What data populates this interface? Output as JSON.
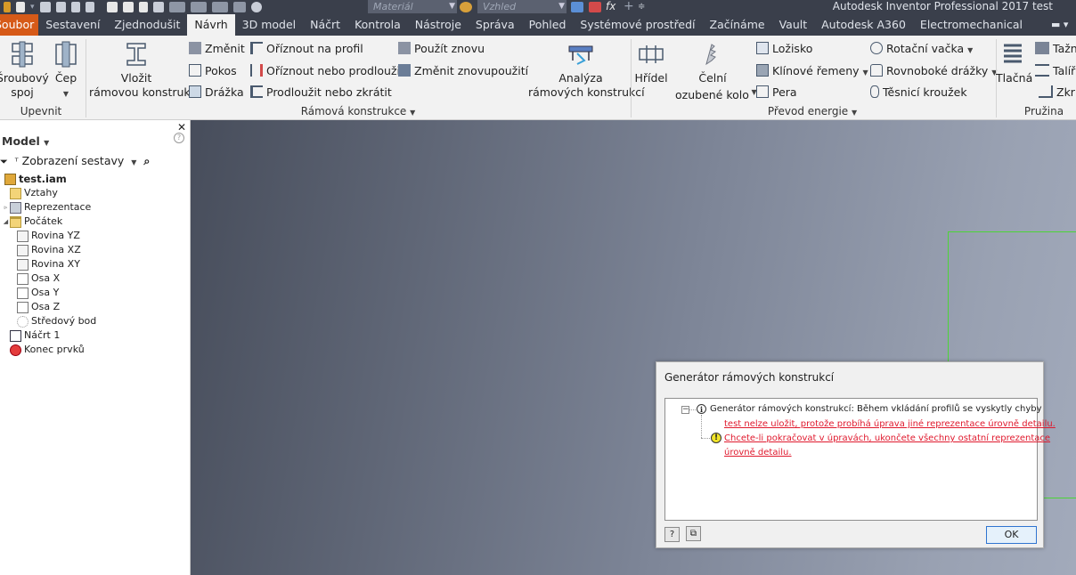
{
  "titlebar": {
    "material_placeholder": "Materiál",
    "appearance_placeholder": "Vzhled",
    "app_title": "Autodesk Inventor Professional 2017   test"
  },
  "tabs": [
    "Soubor",
    "Sestavení",
    "Zjednodušit",
    "Návrh",
    "3D model",
    "Náčrt",
    "Kontrola",
    "Nástroje",
    "Správa",
    "Pohled",
    "Systémové prostředí",
    "Začínáme",
    "Vault",
    "Autodesk A360",
    "Electromechanical"
  ],
  "active_tab": "Návrh",
  "ribbon": {
    "upevnit": {
      "label": "Upevnit",
      "bolt_line1": "Šroubový",
      "bolt_line2": "spoj",
      "pin": "Čep"
    },
    "frame": {
      "label": "Rámová konstrukce",
      "insert_line1": "Vložit",
      "insert_line2": "rámovou konstrukci",
      "change": "Změnit",
      "miter": "Pokos",
      "notch": "Drážka",
      "trim_to_profile": "Oříznout na profil",
      "trim_extend": "Oříznout nebo prodloužit",
      "lengthen_shorten": "Prodloužit nebo zkrátit",
      "reuse": "Použít znovu",
      "change_reuse": "Změnit znovupoužití",
      "analysis_line1": "Analýza",
      "analysis_line2": "rámových konstrukcí"
    },
    "power": {
      "label": "Převod energie",
      "shaft": "Hřídel",
      "spur_line1": "Čelní",
      "spur_line2": "ozubené kolo",
      "bearing": "Ložisko",
      "vbelts": "Klínové řemeny",
      "key": "Pera",
      "cam": "Rotační vačka",
      "splines": "Rovnoboké drážky",
      "oring": "Těsnicí kroužek"
    },
    "spring": {
      "label": "Pružina",
      "compression": "Tlačná",
      "tension": "Tažn",
      "belleville": "Talíř",
      "torsion": "Zkru"
    }
  },
  "browser": {
    "header": "Model",
    "view_label": "Zobrazení sestavy",
    "tree": [
      {
        "label": "test.iam",
        "level": 0,
        "icon": "assembly-icon",
        "root": true,
        "twisty": ""
      },
      {
        "label": "Vztahy",
        "level": 1,
        "icon": "folder-icon",
        "twisty": ""
      },
      {
        "label": "Reprezentace",
        "level": 1,
        "icon": "representations-icon",
        "twisty": "▹"
      },
      {
        "label": "Počátek",
        "level": 1,
        "icon": "open-folder-icon",
        "twisty": "◢"
      },
      {
        "label": "Rovina YZ",
        "level": 2,
        "icon": "plane-icon",
        "twisty": ""
      },
      {
        "label": "Rovina XZ",
        "level": 2,
        "icon": "plane-icon",
        "twisty": ""
      },
      {
        "label": "Rovina XY",
        "level": 2,
        "icon": "plane-icon",
        "twisty": ""
      },
      {
        "label": "Osa X",
        "level": 2,
        "icon": "axis-icon",
        "twisty": ""
      },
      {
        "label": "Osa Y",
        "level": 2,
        "icon": "axis-icon",
        "twisty": ""
      },
      {
        "label": "Osa Z",
        "level": 2,
        "icon": "axis-icon",
        "twisty": ""
      },
      {
        "label": "Středový bod",
        "level": 2,
        "icon": "center-point-icon",
        "twisty": ""
      },
      {
        "label": "Náčrt 1",
        "level": 1,
        "icon": "sketch-icon",
        "twisty": ""
      },
      {
        "label": "Konec prvků",
        "level": 1,
        "icon": "end-of-features-icon",
        "twisty": ""
      }
    ]
  },
  "dialog": {
    "title": "Generátor rámových konstrukcí",
    "header_msg": "Generátor rámových konstrukcí: Během vkládání profilů se vyskytly chyby",
    "error_line": "test nelze uložit, protože probíhá úprava jiné reprezentace úrovně detailu.",
    "warn_line1": "Chcete-li pokračovat v úpravách, ukončete všechny ostatní reprezentace",
    "warn_line2": "úrovně detailu.",
    "ok": "OK"
  },
  "colors": {
    "file_tab": "#d65a18",
    "dark_bar": "#3a3f4b",
    "sketch_line": "#4cd437",
    "error_text": "#e0192d"
  }
}
